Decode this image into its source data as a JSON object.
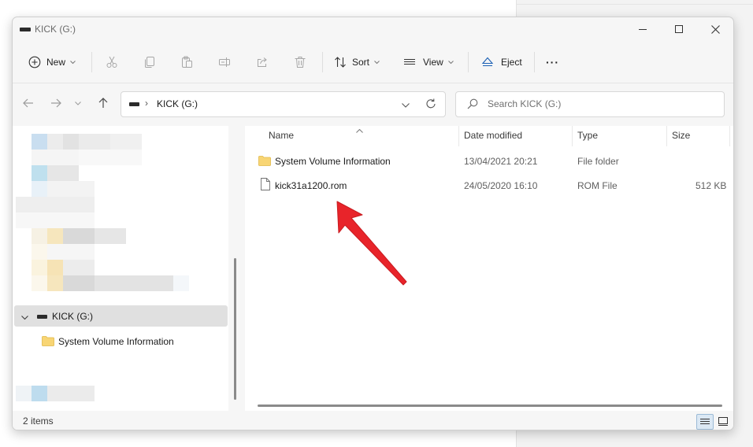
{
  "window": {
    "title": "KICK (G:)"
  },
  "toolbar": {
    "new_label": "New",
    "sort_label": "Sort",
    "view_label": "View",
    "eject_label": "Eject",
    "more_label": "···"
  },
  "address": {
    "separator": "›",
    "path": "KICK (G:)"
  },
  "search": {
    "placeholder": "Search KICK (G:)"
  },
  "nav": {
    "drive_label": "KICK (G:)",
    "child_label": "System Volume Information"
  },
  "columns": {
    "name": "Name",
    "date": "Date modified",
    "type": "Type",
    "size": "Size"
  },
  "files": [
    {
      "name": "System Volume Information",
      "date": "13/04/2021 20:21",
      "type": "File folder",
      "size": "",
      "icon": "folder-icon"
    },
    {
      "name": "kick31a1200.rom",
      "date": "24/05/2020 16:10",
      "type": "ROM File",
      "size": "512 KB",
      "icon": "file-icon"
    }
  ],
  "status": {
    "items": "2 items"
  },
  "colors": {
    "accent_arrow": "#e8242a",
    "folder": "#f8d574",
    "selection": "#e0e0e0"
  }
}
